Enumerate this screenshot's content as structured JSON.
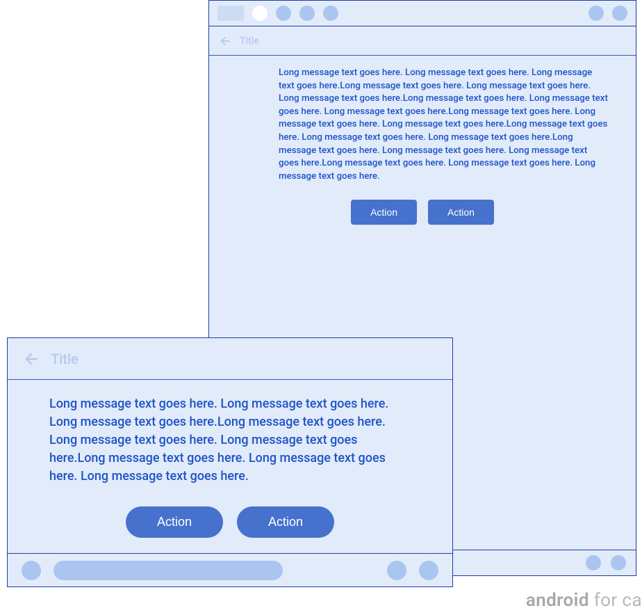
{
  "colors": {
    "pale_blue": "#e2ebfa",
    "soft_blue": "#aac5f0",
    "brand_blue": "#4671cc",
    "text_blue": "#1e54c7",
    "label_blue": "#b6c9ec"
  },
  "tablet": {
    "title": "Title",
    "message": "Long message text goes here. Long message text goes here. Long message text goes here.Long message text goes here. Long message text goes here. Long message text goes here.Long message text goes here. Long message text goes here. Long message text goes here.Long message text goes here. Long message text goes here. Long message text goes here.Long message text goes here. Long message text goes here. Long message text goes here.Long message text goes here. Long message text goes here. Long message text goes here.Long message text goes here. Long message text goes here. Long message text goes here.",
    "buttons": {
      "primary": "Action",
      "secondary": "Action"
    }
  },
  "phone": {
    "title": "Title",
    "message": "Long message text goes here. Long message text goes here. Long message text goes here.Long message text goes here. Long message text goes here. Long message text goes here.Long message text goes here. Long message text goes here. Long message text goes here.",
    "buttons": {
      "primary": "Action",
      "secondary": "Action"
    }
  },
  "watermark": {
    "bold": "android",
    "rest": " for ca"
  }
}
